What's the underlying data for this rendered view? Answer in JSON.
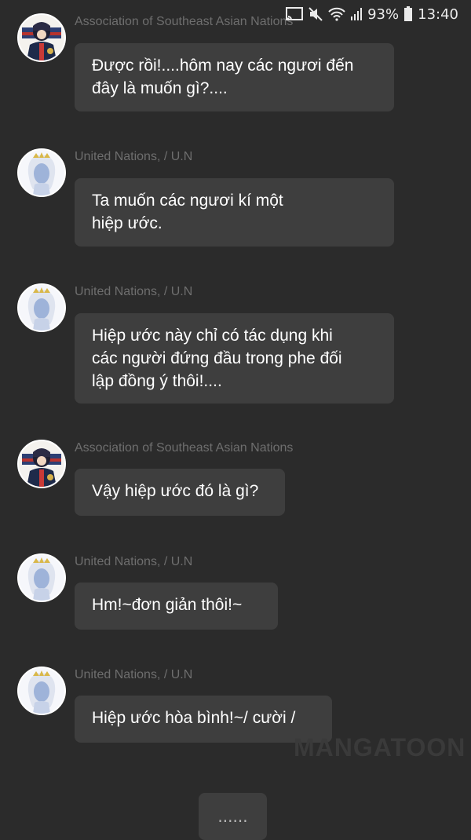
{
  "status_bar": {
    "battery": "93%",
    "time": "13:40",
    "icons": [
      "cast-icon",
      "mute-icon",
      "wifi-icon",
      "signal-icon",
      "battery-icon"
    ]
  },
  "messages": [
    {
      "sender": "Association of Southeast Asian Nations",
      "avatar": "asean-avatar",
      "text": "Được rồi!....hôm nay các ngươi đến\nđây là muốn gì?...."
    },
    {
      "sender": "United Nations, / U.N",
      "avatar": "un-avatar",
      "text": "Ta muốn các ngươi kí một\nhiệp ước."
    },
    {
      "sender": "United Nations, / U.N",
      "avatar": "un-avatar",
      "text": "Hiệp ước này chỉ có tác dụng khi\ncác người đứng đầu trong phe đối\nlập đồng ý thôi!...."
    },
    {
      "sender": "Association of Southeast Asian Nations",
      "avatar": "asean-avatar",
      "text": "Vậy hiệp ước đó là gì?"
    },
    {
      "sender": "United Nations, / U.N",
      "avatar": "un-avatar",
      "text": "Hm!~đơn giản thôi!~"
    },
    {
      "sender": "United Nations, / U.N",
      "avatar": "un-avatar",
      "text": "Hiệp ước hòa bình!~/ cười /"
    }
  ],
  "watermark": "MANGATOON",
  "more_button": "......",
  "colors": {
    "background": "#2b2b2b",
    "bubble": "#3e3e3e",
    "sender_text": "#6e6e6e",
    "message_text": "#ffffff"
  }
}
